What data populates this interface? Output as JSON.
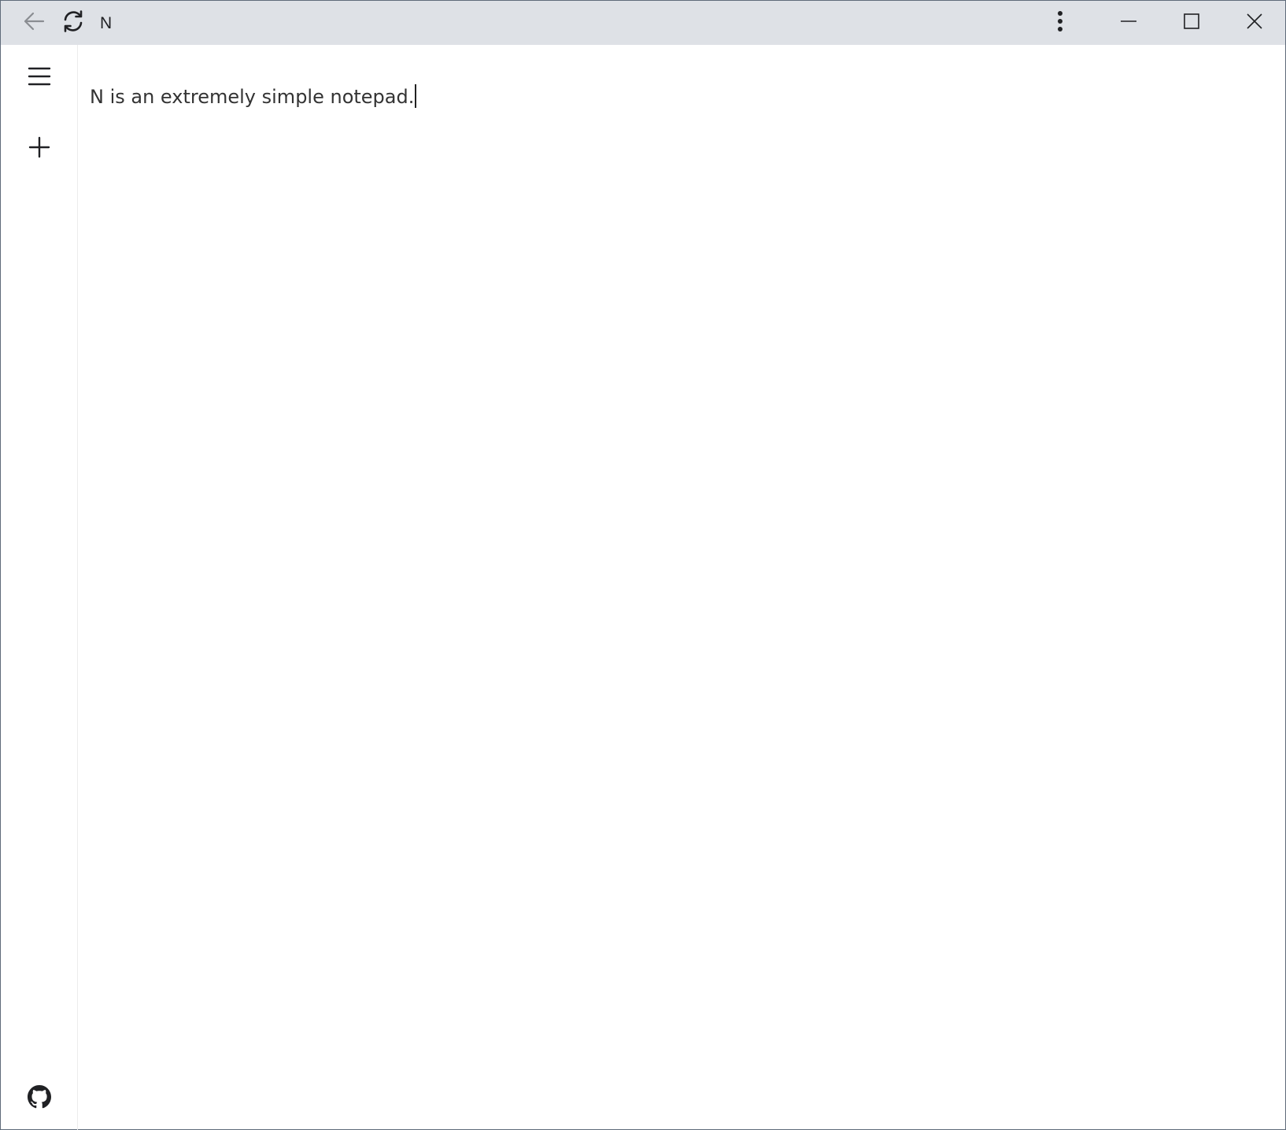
{
  "app": {
    "title": "N"
  },
  "titlebar": {
    "icons": [
      "back-arrow-icon",
      "reload-icon",
      "more-vert-icon",
      "minimize-icon",
      "maximize-icon",
      "close-icon"
    ]
  },
  "sidebar": {
    "icons": [
      "hamburger-menu-icon",
      "plus-icon",
      "github-icon"
    ]
  },
  "editor": {
    "content": "N is an extremely simple notepad."
  },
  "colors": {
    "titlebar_bg": "#dee1e6",
    "window_border": "#5f6b7a",
    "text": "#333333"
  }
}
